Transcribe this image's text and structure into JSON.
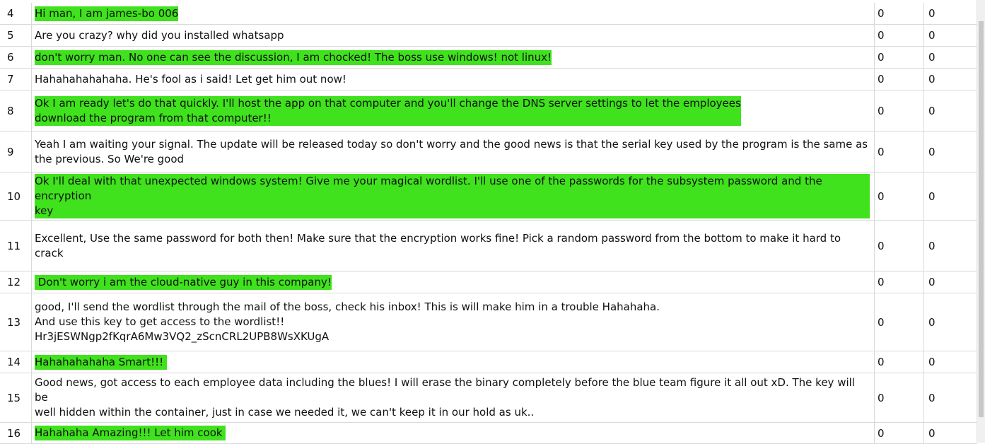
{
  "rows": [
    {
      "num": "4",
      "text": "Hi man, I am james-bo 006",
      "a": "0",
      "b": "0",
      "highlight": true
    },
    {
      "num": "5",
      "text": "Are you crazy? why did you installed whatsapp",
      "a": "0",
      "b": "0",
      "highlight": false
    },
    {
      "num": "6",
      "text": "don't worry man. No one can see the discussion, I am chocked! The boss use windows! not linux!",
      "a": "0",
      "b": "0",
      "highlight": true
    },
    {
      "num": "7",
      "text": "Hahahahahahaha. He's fool as i said! Let get him out now!",
      "a": "0",
      "b": "0",
      "highlight": false
    },
    {
      "num": "8",
      "text": "Ok I am ready let's do that quickly. I'll host the app on that computer and you'll change the DNS server settings to let the employees\ndownload the program from that computer!! ",
      "a": "0",
      "b": "0",
      "highlight": true
    },
    {
      "num": "9",
      "text": "Yeah I am waiting your signal. The update will be released today so don't worry and the good news is that the serial key used by the program is the same as\nthe previous. So We're good",
      "a": "0",
      "b": "0",
      "highlight": false
    },
    {
      "num": "10",
      "text": "Ok I'll deal with that unexpected windows system! Give me your magical wordlist. I'll use one of the passwords for the subsystem password and the encryption\nkey ",
      "a": "0",
      "b": "0",
      "highlight": true
    },
    {
      "num": "11",
      "text": "Excellent, Use the same password for both then! Make sure that the encryption works fine! Pick a random password from the bottom to make it hard to crack",
      "a": "0",
      "b": "0",
      "highlight": false
    },
    {
      "num": "12",
      "text": " Don't worry i am the cloud-native guy in this company!",
      "a": "0",
      "b": "0",
      "highlight": true
    },
    {
      "num": "13",
      "text": "good, I'll send the wordlist through the mail of the boss, check his inbox! This is will make him in a trouble Hahahaha.\nAnd use this key to get access to the wordlist!!\nHr3jESWNgp2fKqrA6Mw3VQ2_zScnCRL2UPB8WsXKUgA",
      "a": "0",
      "b": "0",
      "highlight": false
    },
    {
      "num": "14",
      "text": "Hahahahahaha Smart!!! ",
      "a": "0",
      "b": "0",
      "highlight": true
    },
    {
      "num": "15",
      "text": "Good news, got access to each employee data including the blues! I will erase the binary completely before the blue team figure it all out xD. The key will be\nwell hidden within the container, just in case we needed it, we can't keep it in our hold as uk..",
      "a": "0",
      "b": "0",
      "highlight": false
    },
    {
      "num": "16",
      "text": "Hahahaha Amazing!!! Let him cook ",
      "a": "0",
      "b": "0",
      "highlight": true
    }
  ]
}
